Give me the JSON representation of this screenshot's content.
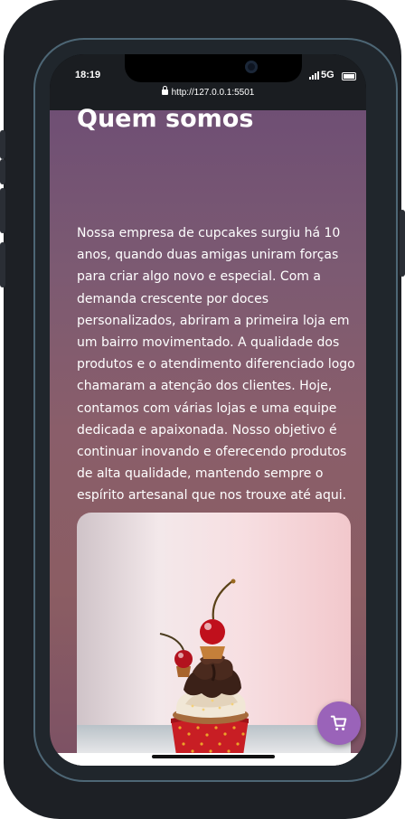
{
  "status_bar": {
    "time": "18:19",
    "network": "5G",
    "icons": [
      "signal-icon",
      "battery-icon"
    ]
  },
  "browser": {
    "url": "http://127.0.0.1:5501",
    "lock_icon": "lock-icon"
  },
  "section": {
    "title": "Quem somos",
    "paragraph": "Nossa empresa de cupcakes surgiu há 10 anos, quando duas amigas uniram forças para criar algo novo e especial. Com a demanda crescente por doces personalizados, abriram a primeira loja em um bairro movimentado. A qualidade dos produtos e o atendimento diferenciado logo chamaram a atenção dos clientes. Hoje, contamos com várias lojas e uma equipe dedicada e apaixonada. Nosso objetivo é continuar inovando e oferecendo produtos de alta qualidade, mantendo sempre o espírito artesanal que nos trouxe até aqui."
  },
  "cart_button": {
    "icon": "shopping-cart-icon",
    "color": "#9a63b9"
  },
  "colors": {
    "gradient_top": "#6f4f74",
    "gradient_bottom": "#7d5264"
  }
}
